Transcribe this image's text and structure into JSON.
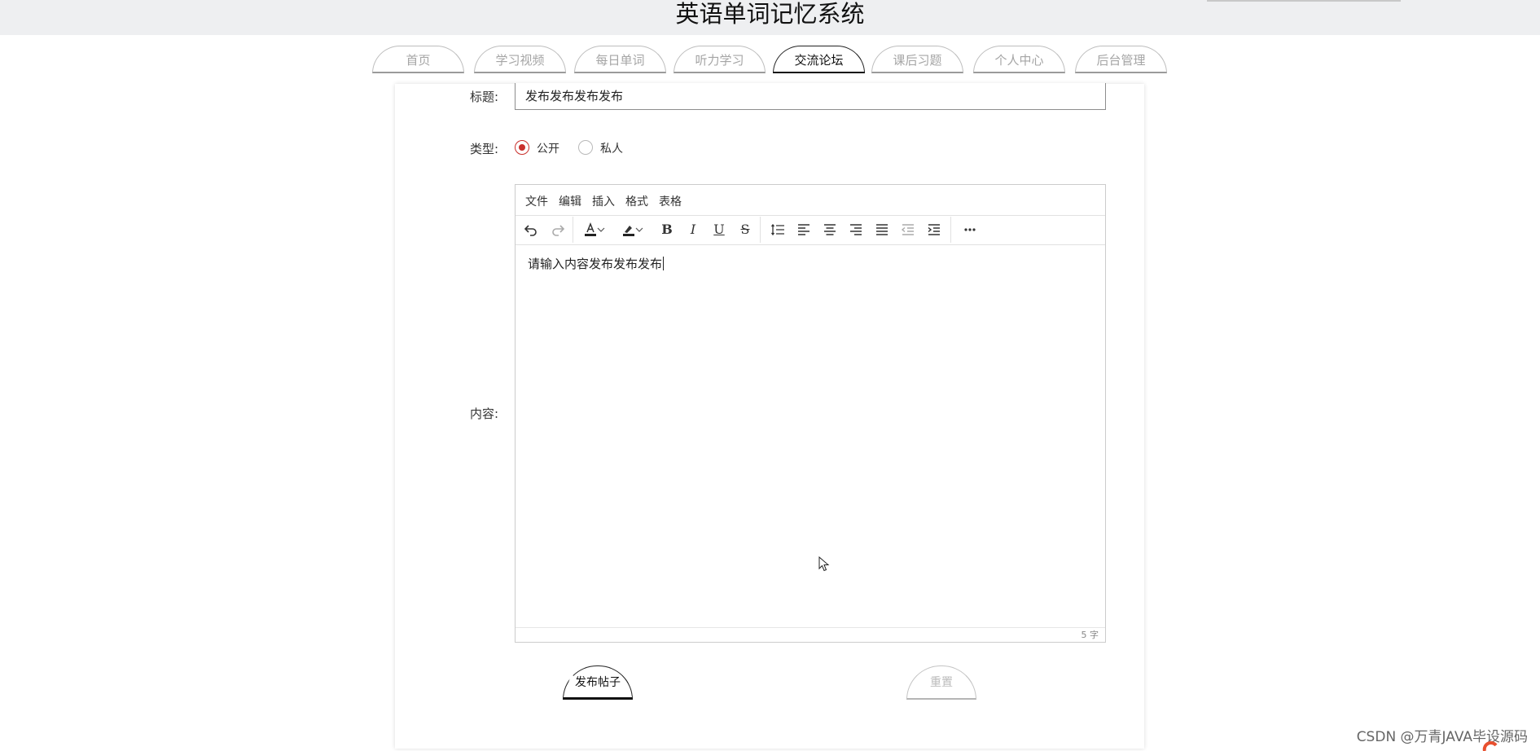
{
  "header": {
    "title": "英语单词记忆系统"
  },
  "nav": {
    "tabs": [
      {
        "label": "首页",
        "active": false
      },
      {
        "label": "学习视频",
        "active": false
      },
      {
        "label": "每日单词",
        "active": false
      },
      {
        "label": "听力学习",
        "active": false
      },
      {
        "label": "交流论坛",
        "active": true
      },
      {
        "label": "课后习题",
        "active": false
      },
      {
        "label": "个人中心",
        "active": false
      },
      {
        "label": "后台管理",
        "active": false
      }
    ]
  },
  "form": {
    "title_label": "标题:",
    "title_value": "发布发布发布发布",
    "type_label": "类型:",
    "type_options": [
      {
        "label": "公开",
        "checked": true
      },
      {
        "label": "私人",
        "checked": false
      }
    ],
    "content_label": "内容:",
    "editor": {
      "menus": [
        "文件",
        "编辑",
        "插入",
        "格式",
        "表格"
      ],
      "toolbar_icons": [
        "undo-icon",
        "redo-icon",
        "font-color-icon",
        "chevron-down-icon",
        "highlight-color-icon",
        "chevron-down-icon",
        "bold-icon",
        "italic-icon",
        "underline-icon",
        "strikethrough-icon",
        "line-height-icon",
        "align-left-icon",
        "align-center-icon",
        "align-right-icon",
        "align-justify-icon",
        "outdent-icon",
        "indent-icon",
        "more-icon"
      ],
      "content": "请输入内容发布发布发布",
      "word_count": "5 字"
    },
    "submit_label": "发布帖子",
    "reset_label": "重置"
  },
  "watermark": "CSDN @万青JAVA毕设源码",
  "colors": {
    "radio_accent": "#c9302c",
    "topbar_bg": "#eeeff1"
  }
}
